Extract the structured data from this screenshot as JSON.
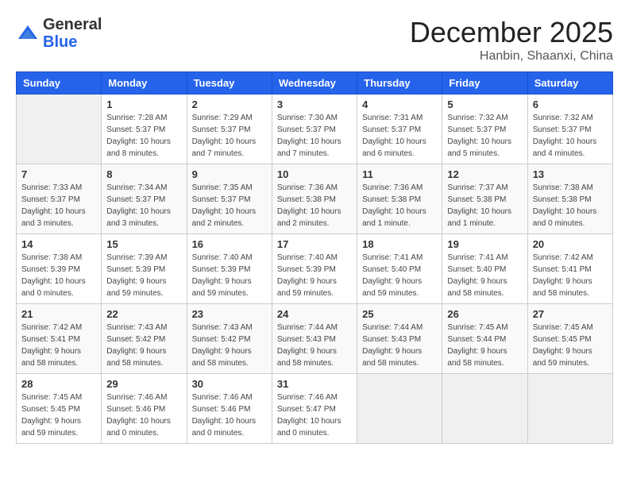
{
  "logo": {
    "general": "General",
    "blue": "Blue"
  },
  "header": {
    "month_year": "December 2025",
    "location": "Hanbin, Shaanxi, China"
  },
  "weekdays": [
    "Sunday",
    "Monday",
    "Tuesday",
    "Wednesday",
    "Thursday",
    "Friday",
    "Saturday"
  ],
  "weeks": [
    [
      {
        "day": "",
        "sunrise": "",
        "sunset": "",
        "daylight": ""
      },
      {
        "day": "1",
        "sunrise": "Sunrise: 7:28 AM",
        "sunset": "Sunset: 5:37 PM",
        "daylight": "Daylight: 10 hours and 8 minutes."
      },
      {
        "day": "2",
        "sunrise": "Sunrise: 7:29 AM",
        "sunset": "Sunset: 5:37 PM",
        "daylight": "Daylight: 10 hours and 7 minutes."
      },
      {
        "day": "3",
        "sunrise": "Sunrise: 7:30 AM",
        "sunset": "Sunset: 5:37 PM",
        "daylight": "Daylight: 10 hours and 7 minutes."
      },
      {
        "day": "4",
        "sunrise": "Sunrise: 7:31 AM",
        "sunset": "Sunset: 5:37 PM",
        "daylight": "Daylight: 10 hours and 6 minutes."
      },
      {
        "day": "5",
        "sunrise": "Sunrise: 7:32 AM",
        "sunset": "Sunset: 5:37 PM",
        "daylight": "Daylight: 10 hours and 5 minutes."
      },
      {
        "day": "6",
        "sunrise": "Sunrise: 7:32 AM",
        "sunset": "Sunset: 5:37 PM",
        "daylight": "Daylight: 10 hours and 4 minutes."
      }
    ],
    [
      {
        "day": "7",
        "sunrise": "Sunrise: 7:33 AM",
        "sunset": "Sunset: 5:37 PM",
        "daylight": "Daylight: 10 hours and 3 minutes."
      },
      {
        "day": "8",
        "sunrise": "Sunrise: 7:34 AM",
        "sunset": "Sunset: 5:37 PM",
        "daylight": "Daylight: 10 hours and 3 minutes."
      },
      {
        "day": "9",
        "sunrise": "Sunrise: 7:35 AM",
        "sunset": "Sunset: 5:37 PM",
        "daylight": "Daylight: 10 hours and 2 minutes."
      },
      {
        "day": "10",
        "sunrise": "Sunrise: 7:36 AM",
        "sunset": "Sunset: 5:38 PM",
        "daylight": "Daylight: 10 hours and 2 minutes."
      },
      {
        "day": "11",
        "sunrise": "Sunrise: 7:36 AM",
        "sunset": "Sunset: 5:38 PM",
        "daylight": "Daylight: 10 hours and 1 minute."
      },
      {
        "day": "12",
        "sunrise": "Sunrise: 7:37 AM",
        "sunset": "Sunset: 5:38 PM",
        "daylight": "Daylight: 10 hours and 1 minute."
      },
      {
        "day": "13",
        "sunrise": "Sunrise: 7:38 AM",
        "sunset": "Sunset: 5:38 PM",
        "daylight": "Daylight: 10 hours and 0 minutes."
      }
    ],
    [
      {
        "day": "14",
        "sunrise": "Sunrise: 7:38 AM",
        "sunset": "Sunset: 5:39 PM",
        "daylight": "Daylight: 10 hours and 0 minutes."
      },
      {
        "day": "15",
        "sunrise": "Sunrise: 7:39 AM",
        "sunset": "Sunset: 5:39 PM",
        "daylight": "Daylight: 9 hours and 59 minutes."
      },
      {
        "day": "16",
        "sunrise": "Sunrise: 7:40 AM",
        "sunset": "Sunset: 5:39 PM",
        "daylight": "Daylight: 9 hours and 59 minutes."
      },
      {
        "day": "17",
        "sunrise": "Sunrise: 7:40 AM",
        "sunset": "Sunset: 5:39 PM",
        "daylight": "Daylight: 9 hours and 59 minutes."
      },
      {
        "day": "18",
        "sunrise": "Sunrise: 7:41 AM",
        "sunset": "Sunset: 5:40 PM",
        "daylight": "Daylight: 9 hours and 59 minutes."
      },
      {
        "day": "19",
        "sunrise": "Sunrise: 7:41 AM",
        "sunset": "Sunset: 5:40 PM",
        "daylight": "Daylight: 9 hours and 58 minutes."
      },
      {
        "day": "20",
        "sunrise": "Sunrise: 7:42 AM",
        "sunset": "Sunset: 5:41 PM",
        "daylight": "Daylight: 9 hours and 58 minutes."
      }
    ],
    [
      {
        "day": "21",
        "sunrise": "Sunrise: 7:42 AM",
        "sunset": "Sunset: 5:41 PM",
        "daylight": "Daylight: 9 hours and 58 minutes."
      },
      {
        "day": "22",
        "sunrise": "Sunrise: 7:43 AM",
        "sunset": "Sunset: 5:42 PM",
        "daylight": "Daylight: 9 hours and 58 minutes."
      },
      {
        "day": "23",
        "sunrise": "Sunrise: 7:43 AM",
        "sunset": "Sunset: 5:42 PM",
        "daylight": "Daylight: 9 hours and 58 minutes."
      },
      {
        "day": "24",
        "sunrise": "Sunrise: 7:44 AM",
        "sunset": "Sunset: 5:43 PM",
        "daylight": "Daylight: 9 hours and 58 minutes."
      },
      {
        "day": "25",
        "sunrise": "Sunrise: 7:44 AM",
        "sunset": "Sunset: 5:43 PM",
        "daylight": "Daylight: 9 hours and 58 minutes."
      },
      {
        "day": "26",
        "sunrise": "Sunrise: 7:45 AM",
        "sunset": "Sunset: 5:44 PM",
        "daylight": "Daylight: 9 hours and 58 minutes."
      },
      {
        "day": "27",
        "sunrise": "Sunrise: 7:45 AM",
        "sunset": "Sunset: 5:45 PM",
        "daylight": "Daylight: 9 hours and 59 minutes."
      }
    ],
    [
      {
        "day": "28",
        "sunrise": "Sunrise: 7:45 AM",
        "sunset": "Sunset: 5:45 PM",
        "daylight": "Daylight: 9 hours and 59 minutes."
      },
      {
        "day": "29",
        "sunrise": "Sunrise: 7:46 AM",
        "sunset": "Sunset: 5:46 PM",
        "daylight": "Daylight: 10 hours and 0 minutes."
      },
      {
        "day": "30",
        "sunrise": "Sunrise: 7:46 AM",
        "sunset": "Sunset: 5:46 PM",
        "daylight": "Daylight: 10 hours and 0 minutes."
      },
      {
        "day": "31",
        "sunrise": "Sunrise: 7:46 AM",
        "sunset": "Sunset: 5:47 PM",
        "daylight": "Daylight: 10 hours and 0 minutes."
      },
      {
        "day": "",
        "sunrise": "",
        "sunset": "",
        "daylight": ""
      },
      {
        "day": "",
        "sunrise": "",
        "sunset": "",
        "daylight": ""
      },
      {
        "day": "",
        "sunrise": "",
        "sunset": "",
        "daylight": ""
      }
    ]
  ]
}
